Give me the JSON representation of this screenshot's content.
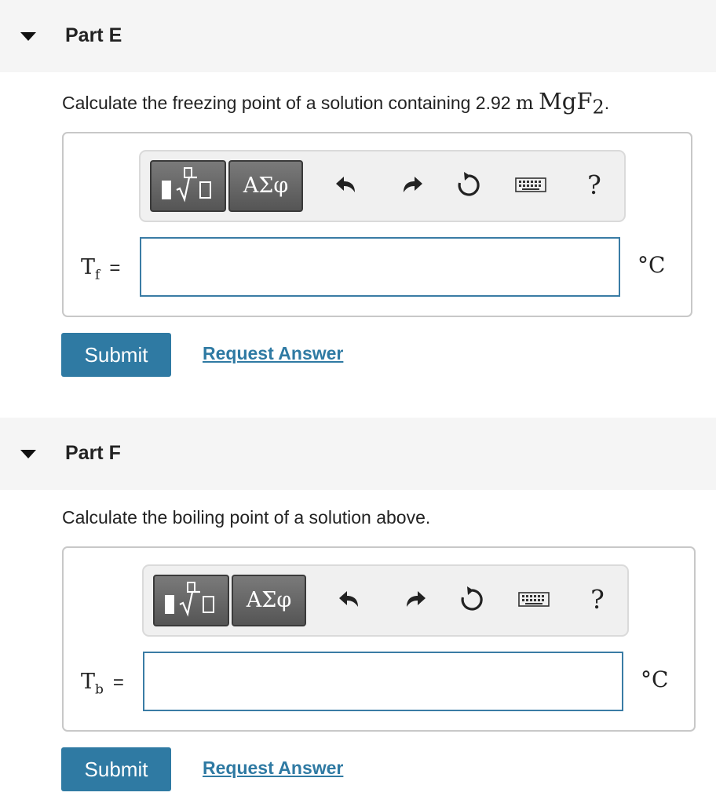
{
  "partE": {
    "title": "Part E",
    "prompt_text": "Calculate the freezing point of a solution containing 2.92 ",
    "prompt_unit": "m",
    "prompt_formula": "MgF",
    "prompt_subscript": "2",
    "prompt_end": ".",
    "toolbar": {
      "greek_label": "ΑΣφ",
      "help_label": "?"
    },
    "variable": "T",
    "variable_sub": "f",
    "equals": "=",
    "input_value": "",
    "unit": "°C",
    "submit_label": "Submit",
    "request_label": "Request Answer"
  },
  "partF": {
    "title": "Part F",
    "prompt_text": "Calculate the boiling point of a solution above.",
    "toolbar": {
      "greek_label": "ΑΣφ",
      "help_label": "?"
    },
    "variable": "T",
    "variable_sub": "b",
    "equals": "=",
    "input_value": "",
    "unit": "°C",
    "submit_label": "Submit",
    "request_label": "Request Answer"
  },
  "colors": {
    "accent": "#2f7aa3",
    "input_border": "#3a7ca5",
    "header_bg": "#f5f5f5"
  }
}
